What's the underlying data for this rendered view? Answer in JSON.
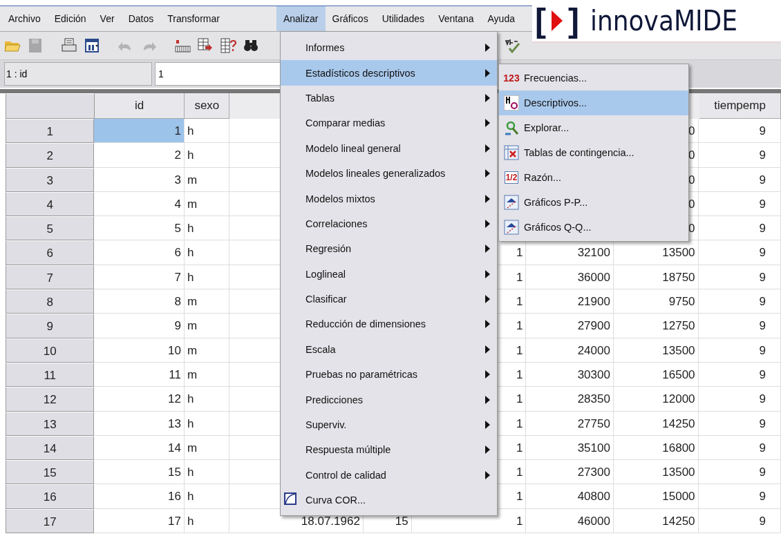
{
  "menubar": [
    {
      "label": "Archivo",
      "selected": false
    },
    {
      "label": "Edición",
      "selected": false
    },
    {
      "label": "Ver",
      "selected": false
    },
    {
      "label": "Datos",
      "selected": false
    },
    {
      "label": "Transformar",
      "selected": false
    },
    {
      "label": "Analizar",
      "selected": true
    },
    {
      "label": "Gráficos",
      "selected": false
    },
    {
      "label": "Utilidades",
      "selected": false
    },
    {
      "label": "Ventana",
      "selected": false
    },
    {
      "label": "Ayuda",
      "selected": false
    }
  ],
  "logo": {
    "left_bracket": "[",
    "name": "innovaMIDE",
    "right_bracket": "]"
  },
  "toolbar": [
    {
      "kind": "folder",
      "disabled": false
    },
    {
      "kind": "save",
      "disabled": true
    },
    {
      "kind": "print",
      "disabled": false
    },
    {
      "kind": "dialog",
      "disabled": false
    },
    {
      "kind": "undo",
      "disabled": true
    },
    {
      "kind": "redo",
      "disabled": true
    },
    {
      "kind": "goto-case",
      "disabled": false
    },
    {
      "kind": "goto-variable",
      "disabled": false
    },
    {
      "kind": "variables",
      "disabled": false
    },
    {
      "kind": "find",
      "disabled": false
    },
    {
      "kind": "spell",
      "disabled": false
    }
  ],
  "cell_reference": "1 : id",
  "cell_value": "1",
  "grid": {
    "columns": [
      {
        "label": "id",
        "kind": "number"
      },
      {
        "label": "sexo",
        "kind": "text"
      },
      {
        "kind": "number"
      },
      {
        "kind": "number"
      },
      {
        "kind": "number"
      },
      {
        "kind": "number"
      },
      {
        "kind": "number"
      },
      {
        "label": "tiempemp",
        "kind": "number"
      }
    ],
    "rows": [
      {
        "number": "1",
        "selected": true,
        "cells": [
          "1",
          "h",
          null,
          null,
          null,
          null,
          "0",
          "9"
        ]
      },
      {
        "number": "2",
        "selected": false,
        "cells": [
          "2",
          "h",
          null,
          null,
          null,
          null,
          "0",
          "9"
        ]
      },
      {
        "number": "3",
        "selected": false,
        "cells": [
          "3",
          "m",
          null,
          null,
          null,
          null,
          "0",
          "9"
        ]
      },
      {
        "number": "4",
        "selected": false,
        "cells": [
          "4",
          "m",
          null,
          null,
          null,
          null,
          "0",
          "9"
        ]
      },
      {
        "number": "5",
        "selected": false,
        "cells": [
          "5",
          "h",
          null,
          null,
          null,
          null,
          "0",
          "9"
        ]
      },
      {
        "number": "6",
        "selected": false,
        "cells": [
          "6",
          "h",
          null,
          null,
          "1",
          "32100",
          "13500",
          "9"
        ]
      },
      {
        "number": "7",
        "selected": false,
        "cells": [
          "7",
          "h",
          null,
          null,
          "1",
          "36000",
          "18750",
          "9"
        ]
      },
      {
        "number": "8",
        "selected": false,
        "cells": [
          "8",
          "m",
          null,
          null,
          "1",
          "21900",
          "9750",
          "9"
        ]
      },
      {
        "number": "9",
        "selected": false,
        "cells": [
          "9",
          "m",
          null,
          null,
          "1",
          "27900",
          "12750",
          "9"
        ]
      },
      {
        "number": "10",
        "selected": false,
        "cells": [
          "10",
          "m",
          null,
          null,
          "1",
          "24000",
          "13500",
          "9"
        ]
      },
      {
        "number": "11",
        "selected": false,
        "cells": [
          "11",
          "m",
          null,
          null,
          "1",
          "30300",
          "16500",
          "9"
        ]
      },
      {
        "number": "12",
        "selected": false,
        "cells": [
          "12",
          "h",
          null,
          null,
          "1",
          "28350",
          "12000",
          "9"
        ]
      },
      {
        "number": "13",
        "selected": false,
        "cells": [
          "13",
          "h",
          null,
          null,
          "1",
          "27750",
          "14250",
          "9"
        ]
      },
      {
        "number": "14",
        "selected": false,
        "cells": [
          "14",
          "m",
          null,
          null,
          "1",
          "35100",
          "16800",
          "9"
        ]
      },
      {
        "number": "15",
        "selected": false,
        "cells": [
          "15",
          "h",
          null,
          null,
          "1",
          "27300",
          "13500",
          "9"
        ]
      },
      {
        "number": "16",
        "selected": false,
        "cells": [
          "16",
          "h",
          null,
          null,
          "1",
          "40800",
          "15000",
          "9"
        ]
      },
      {
        "number": "17",
        "selected": false,
        "cells": [
          "17",
          "h",
          "18.07.1962",
          "15",
          "1",
          "46000",
          "14250",
          "9"
        ]
      }
    ]
  },
  "analyze_menu": {
    "items": [
      {
        "label": "Informes",
        "submenu": true,
        "selected": false
      },
      {
        "label": "Estadísticos descriptivos",
        "submenu": true,
        "selected": true
      },
      {
        "label": "Tablas",
        "submenu": true,
        "selected": false
      },
      {
        "label": "Comparar medias",
        "submenu": true,
        "selected": false
      },
      {
        "label": "Modelo lineal general",
        "submenu": true,
        "selected": false
      },
      {
        "label": "Modelos lineales generalizados",
        "submenu": true,
        "selected": false
      },
      {
        "label": "Modelos mixtos",
        "submenu": true,
        "selected": false
      },
      {
        "label": "Correlaciones",
        "submenu": true,
        "selected": false
      },
      {
        "label": "Regresión",
        "submenu": true,
        "selected": false
      },
      {
        "label": "Loglineal",
        "submenu": true,
        "selected": false
      },
      {
        "label": "Clasificar",
        "submenu": true,
        "selected": false
      },
      {
        "label": "Reducción de dimensiones",
        "submenu": true,
        "selected": false
      },
      {
        "label": "Escala",
        "submenu": true,
        "selected": false
      },
      {
        "label": "Pruebas no paramétricas",
        "submenu": true,
        "selected": false
      },
      {
        "label": "Predicciones",
        "submenu": true,
        "selected": false
      },
      {
        "label": "Superviv.",
        "submenu": true,
        "selected": false
      },
      {
        "label": "Respuesta múltiple",
        "submenu": true,
        "selected": false
      },
      {
        "label": "Control de calidad",
        "submenu": true,
        "selected": false
      },
      {
        "label": "Curva COR...",
        "submenu": false,
        "selected": false,
        "kind": "curve"
      }
    ]
  },
  "descriptives_menu": {
    "items": [
      {
        "label": "Frecuencias...",
        "selected": false,
        "kind": "digits",
        "icon_text": "123"
      },
      {
        "label": "Descriptivos...",
        "selected": true,
        "kind": "stats"
      },
      {
        "label": "Explorar...",
        "selected": false,
        "kind": "explore"
      },
      {
        "label": "Tablas de contingencia...",
        "selected": false,
        "kind": "crosstab"
      },
      {
        "label": "Razón...",
        "selected": false,
        "kind": "ratio",
        "icon_text": "1/2"
      },
      {
        "label": "Gráficos P-P...",
        "selected": false,
        "kind": "plot"
      },
      {
        "label": "Gráficos Q-Q...",
        "selected": false,
        "kind": "plot"
      }
    ]
  }
}
